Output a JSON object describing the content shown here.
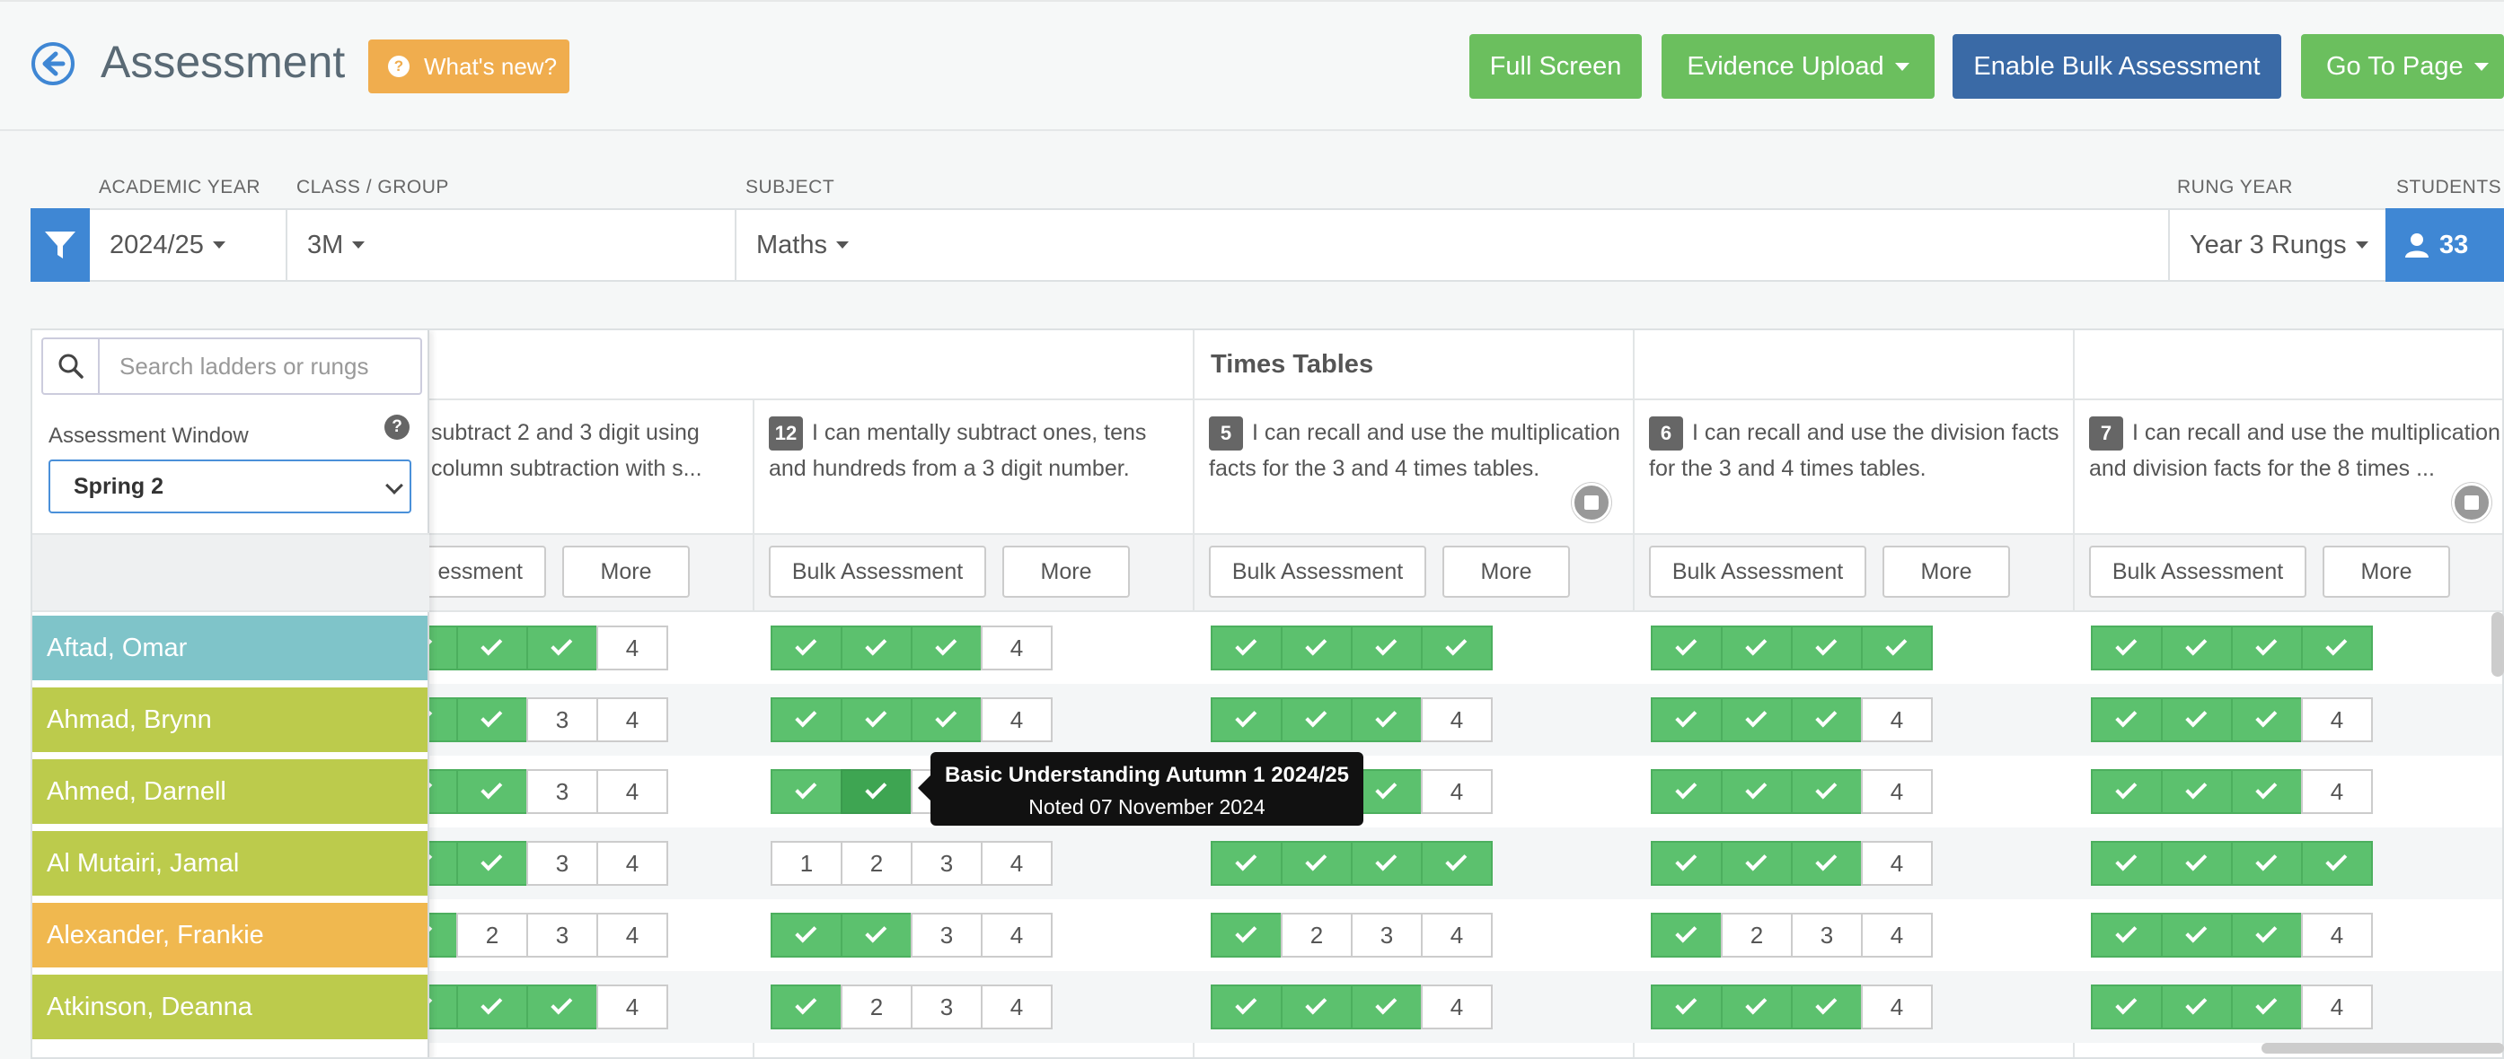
{
  "header": {
    "title": "Assessment",
    "whats_new": "What's new?",
    "buttons": {
      "full_screen": "Full Screen",
      "evidence_upload": "Evidence Upload",
      "enable_bulk": "Enable Bulk Assessment",
      "go_to_page": "Go To Page"
    }
  },
  "filters": {
    "labels": {
      "academic_year": "ACADEMIC YEAR",
      "class_group": "CLASS / GROUP",
      "subject": "SUBJECT",
      "rung_year": "RUNG YEAR",
      "students": "STUDENTS"
    },
    "academic_year": "2024/25",
    "class_group": "3M",
    "subject": "Maths",
    "rung_year": "Year 3 Rungs",
    "students_count": "33"
  },
  "panel": {
    "search_placeholder": "Search ladders or rungs",
    "assessment_window_label": "Assessment Window",
    "assessment_window_value": "Spring 2",
    "help": "?"
  },
  "section_title": "Times Tables",
  "columns": [
    {
      "number": "",
      "text": "subtract 2 and 3 digit using column subtraction with s...",
      "bulk": "essment",
      "more": "More",
      "note": false
    },
    {
      "number": "12",
      "text": "I can mentally subtract ones, tens and hundreds from a 3 digit number.",
      "bulk": "Bulk Assessment",
      "more": "More",
      "note": false
    },
    {
      "number": "5",
      "text": "I can recall and use the multiplication facts for the 3 and 4 times tables.",
      "bulk": "Bulk Assessment",
      "more": "More",
      "note": true
    },
    {
      "number": "6",
      "text": "I can recall and use the division facts for the 3 and 4 times tables.",
      "bulk": "Bulk Assessment",
      "more": "More",
      "note": false
    },
    {
      "number": "7",
      "text": "I can recall and use the multiplication and division facts for the 8 times ...",
      "bulk": "Bulk Assessment",
      "more": "More",
      "note": true
    }
  ],
  "students": [
    {
      "name": "Aftad, Omar",
      "color": "#7fc4c9"
    },
    {
      "name": "Ahmad, Brynn",
      "color": "#bccb4c"
    },
    {
      "name": "Ahmed, Darnell",
      "color": "#bccb4c"
    },
    {
      "name": "Al Mutairi, Jamal",
      "color": "#bccb4c"
    },
    {
      "name": "Alexander, Frankie",
      "color": "#f0b84f"
    },
    {
      "name": "Atkinson, Deanna",
      "color": "#bccb4c"
    }
  ],
  "grid": [
    [
      3,
      3,
      4,
      4,
      4
    ],
    [
      2,
      3,
      3,
      3,
      3
    ],
    [
      2,
      2,
      3,
      3,
      3
    ],
    [
      2,
      0,
      4,
      3,
      4
    ],
    [
      1,
      2,
      1,
      1,
      3
    ],
    [
      3,
      1,
      3,
      3,
      3
    ]
  ],
  "tooltip": {
    "line1": "Basic Understanding Autumn 1 2024/25",
    "line2": "Noted 07 November 2024"
  },
  "colors": {
    "green": "#5cc16e",
    "blue_accent": "#3f87d4",
    "orange": "#f0ad4e",
    "dark_blue": "#3a6aa6"
  }
}
